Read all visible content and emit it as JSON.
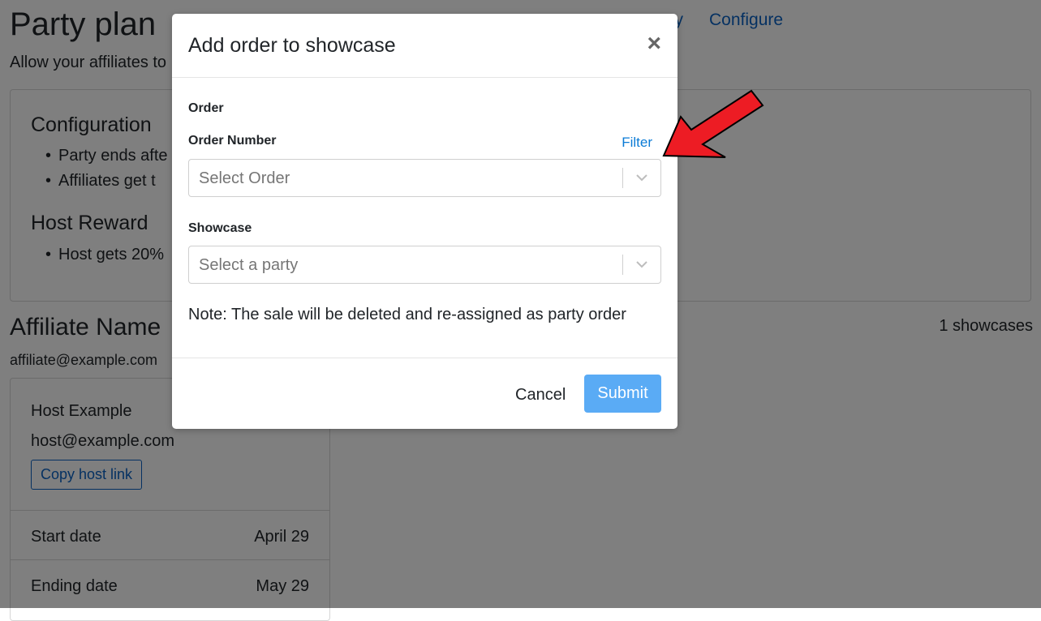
{
  "page": {
    "title": "Party plan",
    "subtitle": "Allow your affiliates to",
    "nav_partial": "y",
    "nav_configure": "Configure"
  },
  "configuration": {
    "heading": "Configuration",
    "items": [
      "Party ends afte",
      "Affiliates get t"
    ]
  },
  "host_reward": {
    "heading": "Host Reward",
    "items": [
      "Host gets 20%"
    ]
  },
  "affiliate": {
    "name": "Affiliate Name",
    "email": "affiliate@example.com",
    "showcase_count": "1 showcases"
  },
  "host": {
    "name": "Host Example",
    "email": "host@example.com",
    "copy_link_label": "Copy host link",
    "start_label": "Start date",
    "start_value": "April 29",
    "end_label": "Ending date",
    "end_value": "May 29"
  },
  "modal": {
    "title": "Add order to showcase",
    "close_symbol": "×",
    "order_label": "Order",
    "order_number_label": "Order Number",
    "filter_label": "Filter",
    "order_placeholder": "Select Order",
    "showcase_label": "Showcase",
    "showcase_placeholder": "Select a party",
    "note": "Note: The sale will be deleted and re-assigned as party order",
    "cancel_label": "Cancel",
    "submit_label": "Submit"
  },
  "colors": {
    "link": "#0b63c4",
    "submit_bg": "#5aabf5",
    "arrow": "#ed1c24"
  },
  "icons": [
    "close-icon",
    "chevron-down-icon",
    "red-arrow-annotation"
  ]
}
